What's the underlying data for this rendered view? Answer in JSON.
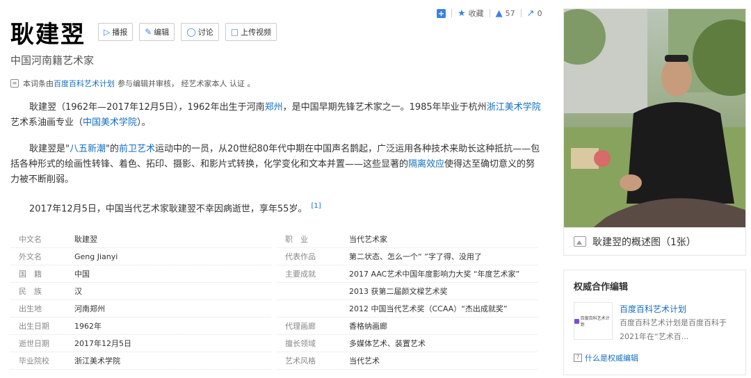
{
  "topbar": {
    "favorite_label": "收藏",
    "like_count": "57",
    "share_count": "0"
  },
  "title": "耿建翌",
  "buttons": {
    "broadcast": "播报",
    "edit": "编辑",
    "discuss": "讨论",
    "upload_video": "上传视频"
  },
  "subtitle": "中国河南籍艺术家",
  "notice": {
    "prefix": "本词条由",
    "link": "百度百科艺术计划",
    "suffix": "参与编辑并审核， 经艺术家本人 认证 。"
  },
  "paragraphs": {
    "p1_a": "耿建翌（1962年—2017年12月5日），1962年出生于河南",
    "p1_link1": "郑州",
    "p1_b": "，是中国早期先锋艺术家之一。1985年毕业于杭州",
    "p1_link2": "浙江美术学院",
    "p1_c": "艺术系油画专业（",
    "p1_link3": "中国美术学院",
    "p1_d": "）。",
    "p2_a": "耿建翌是\"",
    "p2_link1": "八五新潮",
    "p2_b": "\"的",
    "p2_link2": "前卫艺术",
    "p2_c": "运动中的一员，从20世纪80年代中期在中国声名鹊起，广泛运用各种技术来助长这种抵抗——包括各种形式的绘画性转锋、着色、拓印、摄影、和影片式转换，化学变化和文本并置——这些显著的",
    "p2_link3": "隔离效应",
    "p2_d": "使得达至确切意义的努力被不断削弱。",
    "p3": "2017年12月5日，中国当代艺术家耿建翌不幸因病逝世，享年55岁。",
    "p3_ref": "[1]"
  },
  "info_left": [
    {
      "key": "中文名",
      "value": "耿建翌",
      "link": false
    },
    {
      "key": "外文名",
      "value": "Geng Jianyi",
      "link": false
    },
    {
      "key": "国　籍",
      "value": "中国",
      "link": true
    },
    {
      "key": "民　族",
      "value": "汉",
      "link": false
    },
    {
      "key": "出生地",
      "value": "河南郑州",
      "link": true
    },
    {
      "key": "出生日期",
      "value": "1962年",
      "link": false
    },
    {
      "key": "逝世日期",
      "value": "2017年12月5日",
      "link": false
    },
    {
      "key": "毕业院校",
      "value": "浙江美术学院",
      "link": true
    }
  ],
  "info_right": [
    {
      "key": "职　业",
      "value": "当代艺术家",
      "link": false
    },
    {
      "key": "代表作品",
      "value": "第二状态、怎么一个“ ”字了得、没用了",
      "link": false
    },
    {
      "key": "主要成就",
      "value": "2017 AAC艺术中国年度影响力大奖 “年度艺术家”",
      "link": false
    },
    {
      "key": "",
      "value": "2013 获第二届颜文樑艺术奖",
      "link": false
    },
    {
      "key": "",
      "value": "2012 中国当代艺术奖（CCAA）“杰出成就奖”",
      "link": false
    },
    {
      "key": "代理画廊",
      "value": "香格纳画廊",
      "link": true
    },
    {
      "key": "擅长领域",
      "value": "多媒体艺术、装置艺术",
      "link": false
    },
    {
      "key": "艺术风格",
      "value": "当代艺术",
      "link": false
    }
  ],
  "photo_caption": "耿建翌的概述图（1张）",
  "coop": {
    "title": "权威合作编辑",
    "name": "百度百科艺术计划",
    "desc_line1": "百度百科艺术计划是百度百科于",
    "desc_line2": "2021年在“艺术百...",
    "logo_text": "百度百科艺术计划",
    "help": "什么是权威编辑"
  },
  "colors": {
    "link": "#136ec2",
    "accent": "#3b82e0"
  }
}
